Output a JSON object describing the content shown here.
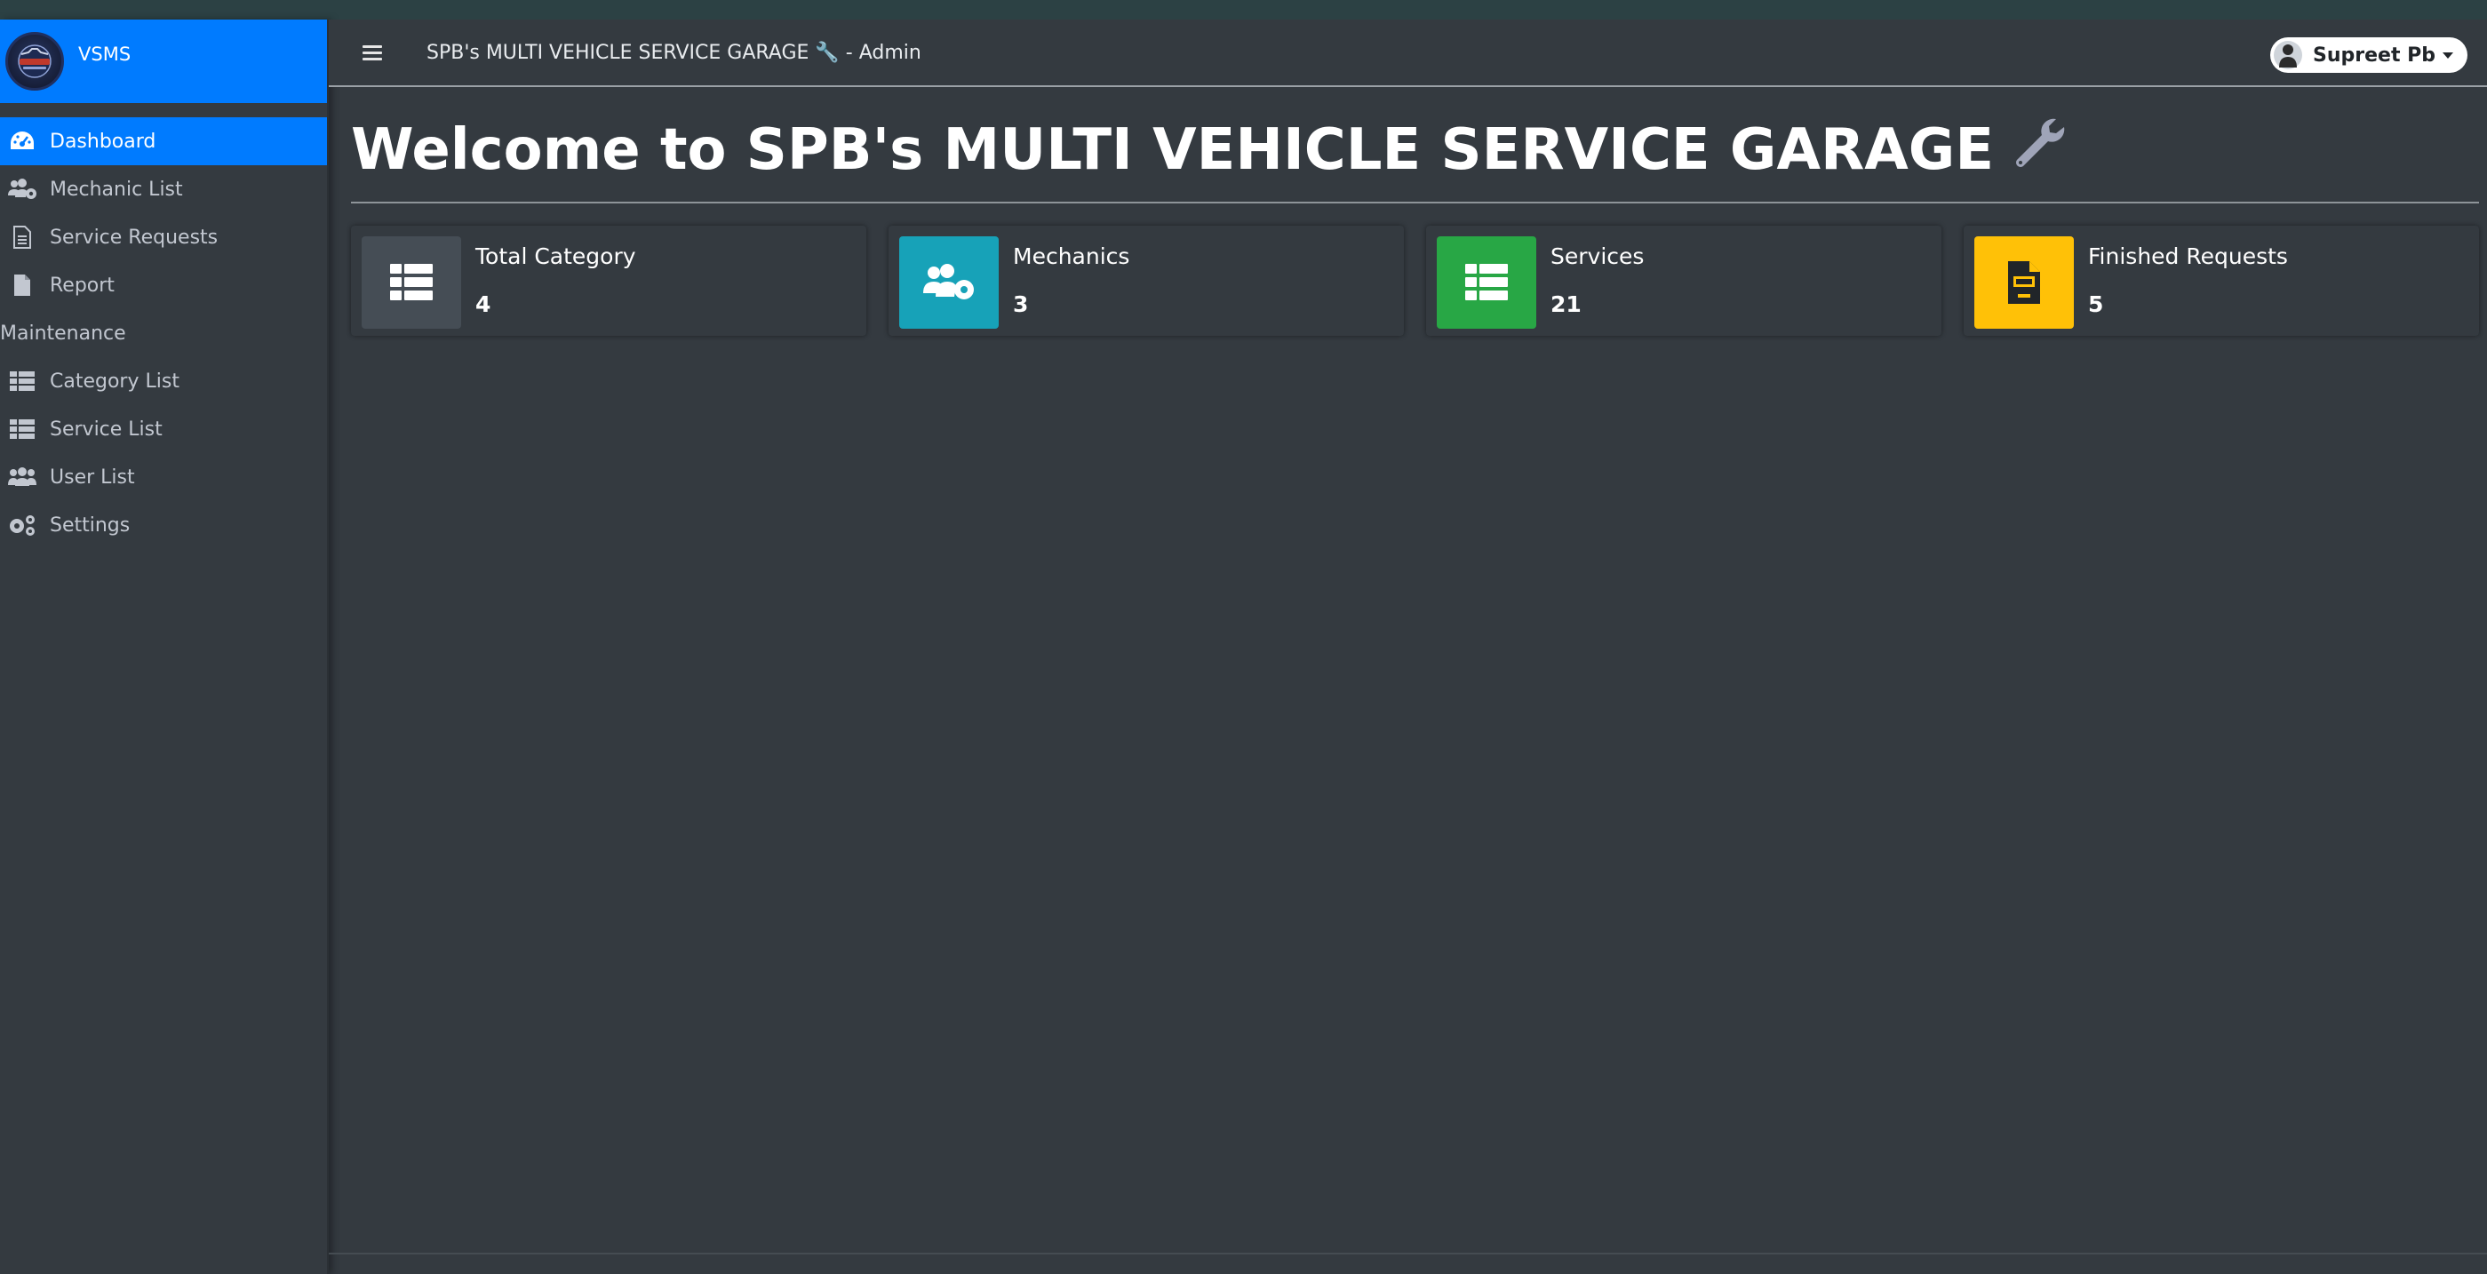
{
  "brand": {
    "name": "VSMS",
    "logo_icon": "auto-repair-logo"
  },
  "sidebar": {
    "items": [
      {
        "label": "Dashboard",
        "icon": "tachometer-icon",
        "active": true
      },
      {
        "label": "Mechanic List",
        "icon": "users-cog-icon"
      },
      {
        "label": "Service Requests",
        "icon": "file-alt-icon"
      },
      {
        "label": "Report",
        "icon": "file-icon"
      }
    ],
    "section_header": "Maintenance",
    "maintenance_items": [
      {
        "label": "Category List",
        "icon": "th-list-icon"
      },
      {
        "label": "Service List",
        "icon": "th-list-icon"
      },
      {
        "label": "User List",
        "icon": "users-icon"
      },
      {
        "label": "Settings",
        "icon": "cogs-icon"
      }
    ]
  },
  "header": {
    "title": "SPB's MULTI VEHICLE SERVICE GARAGE 🔧 - Admin",
    "user_name": "Supreet Pb"
  },
  "main": {
    "welcome": "Welcome to SPB's MULTI VEHICLE SERVICE GARAGE",
    "cards": [
      {
        "label": "Total Category",
        "value": "4",
        "color": "#454d55",
        "icon": "th-list-icon"
      },
      {
        "label": "Mechanics",
        "value": "3",
        "color": "#17a2b8",
        "icon": "users-cog-icon"
      },
      {
        "label": "Services",
        "value": "21",
        "color": "#28a745",
        "icon": "th-list-icon"
      },
      {
        "label": "Finished Requests",
        "value": "5",
        "color": "#ffc107",
        "icon": "file-invoice-icon"
      }
    ]
  },
  "colors": {
    "primary": "#007bff",
    "background": "#343a40",
    "info": "#17a2b8",
    "success": "#28a745",
    "warning": "#ffc107"
  }
}
